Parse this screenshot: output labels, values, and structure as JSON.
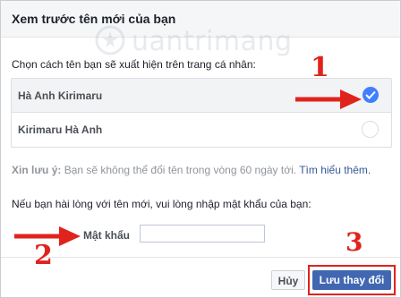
{
  "dialog": {
    "title": "Xem trước tên mới của bạn",
    "prompt": "Chọn cách tên bạn sẽ xuất hiện trên trang cá nhân:",
    "options": [
      {
        "label": "Hà Anh Kirimaru",
        "selected": true
      },
      {
        "label": "Kirimaru Hà Anh",
        "selected": false
      }
    ],
    "note": {
      "prefix": "Xin lưu ý:",
      "text": " Bạn sẽ không thể đổi tên trong vòng 60 ngày tới. ",
      "link": "Tìm hiểu thêm."
    },
    "confirm_text": "Nếu bạn hài lòng với tên mới, vui lòng nhập mật khẩu của bạn:",
    "password": {
      "label": "Mật khẩu",
      "value": ""
    },
    "buttons": {
      "cancel": "Hủy",
      "save": "Lưu thay đổi"
    }
  },
  "annotations": {
    "step1": "1",
    "step2": "2",
    "step3": "3"
  },
  "watermark": {
    "text": "uantrimang"
  },
  "colors": {
    "accent": "#4267b2",
    "radio": "#4080ff",
    "annotation": "#e0231c",
    "link": "#365899"
  }
}
